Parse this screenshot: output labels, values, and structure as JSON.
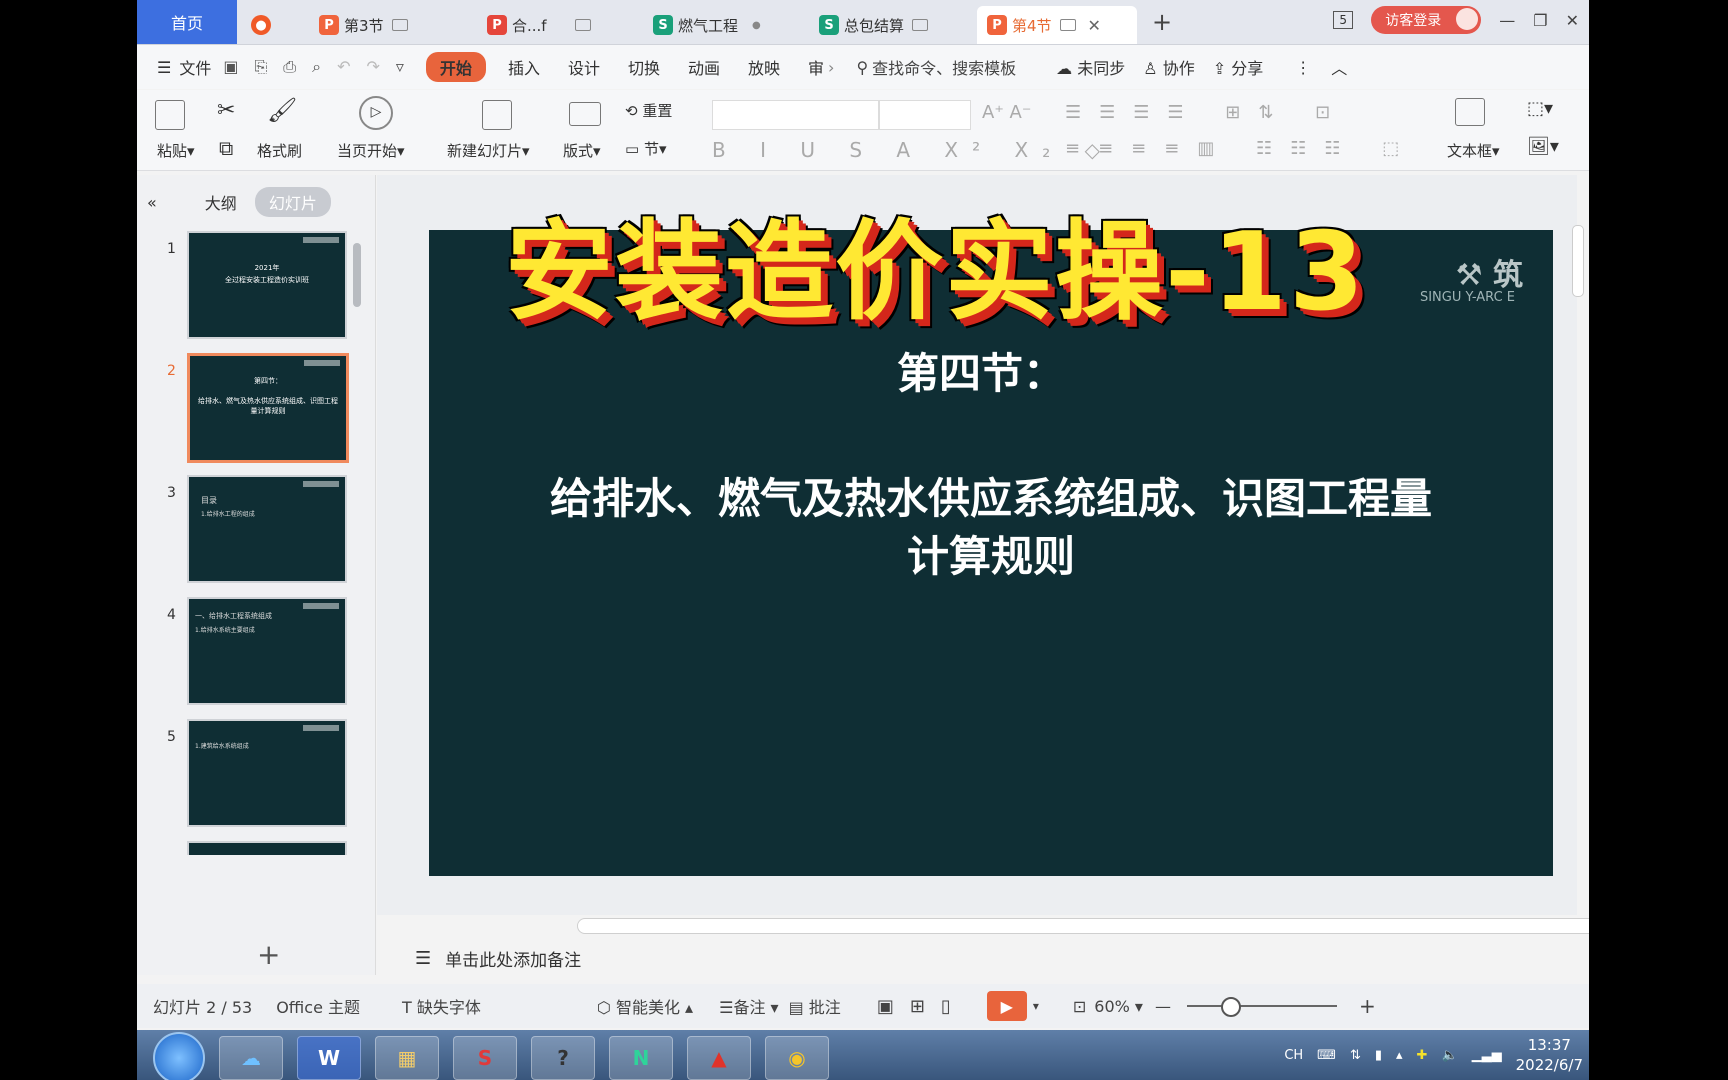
{
  "overlay_title": "安装造价实操-13",
  "tabs": {
    "home": "首页",
    "items": [
      {
        "label": "第3节",
        "icon": "P",
        "color": "#f0643c"
      },
      {
        "label": "合...f",
        "icon": "P",
        "color": "#e5463b"
      },
      {
        "label": "燃气工程",
        "icon": "S",
        "color": "#1aa07a"
      },
      {
        "label": "总包结算",
        "icon": "S",
        "color": "#1aa07a"
      },
      {
        "label": "第4节",
        "icon": "P",
        "color": "#f0643c"
      }
    ],
    "new_tab": "+",
    "window_count": "5",
    "guest_login": "访客登录"
  },
  "menu": {
    "file": "文件",
    "start": "开始",
    "insert": "插入",
    "design": "设计",
    "transition": "切换",
    "animation": "动画",
    "slideshow": "放映",
    "review": "审",
    "search": "查找命令、搜索模板",
    "unsynced": "未同步",
    "collaborate": "协作",
    "share": "分享"
  },
  "ribbon": {
    "paste": "粘贴",
    "format_painter": "格式刷",
    "from_current": "当页开始",
    "new_slide": "新建幻灯片",
    "layout": "版式",
    "reset": "重置",
    "section": "节",
    "textbox": "文本框"
  },
  "left_panel": {
    "outline": "大纲",
    "slides": "幻灯片",
    "thumbnails": [
      {
        "num": "1",
        "title": "2021年",
        "sub": "全过程安装工程造价实训班"
      },
      {
        "num": "2",
        "title": "第四节：",
        "sub": "给排水、燃气及热水供应系统组成、识图工程量计算规则"
      },
      {
        "num": "3",
        "title": "目录",
        "sub": "1.给排水工程的组成"
      },
      {
        "num": "4",
        "title": "一、给排水工程系统组成",
        "sub": "1.给排水系统主要组成"
      },
      {
        "num": "5",
        "title": "",
        "sub": "1.建筑给水系统组成"
      }
    ]
  },
  "slide": {
    "section": "第四节：",
    "line1": "给排水、燃气及热水供应系统组成、识图工程量",
    "line2": "计算规则",
    "logo_en": "SINGU  Y-ARC  E"
  },
  "notes_placeholder": "单击此处添加备注",
  "status": {
    "slide_count": "幻灯片 2 / 53",
    "theme": "Office 主题",
    "missing_font": "缺失字体",
    "beautify": "智能美化",
    "notes": "备注",
    "comments": "批注",
    "zoom": "60%"
  },
  "taskbar": {
    "ime": "CH",
    "time": "13:37",
    "date": "2022/6/7"
  }
}
